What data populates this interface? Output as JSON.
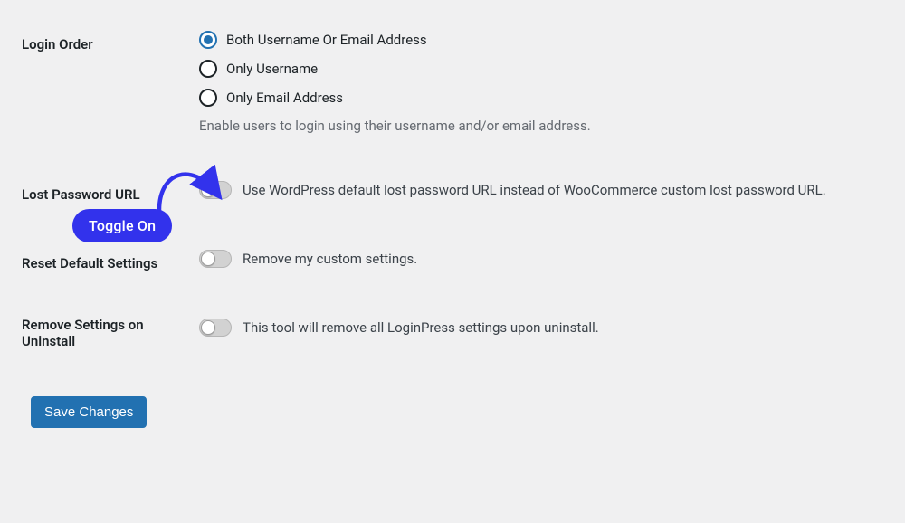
{
  "loginOrder": {
    "label": "Login Order",
    "options": [
      {
        "label": "Both Username Or Email Address",
        "checked": true
      },
      {
        "label": "Only Username",
        "checked": false
      },
      {
        "label": "Only Email Address",
        "checked": false
      }
    ],
    "help": "Enable users to login using their username and/or email address."
  },
  "lostPassword": {
    "label": "Lost Password URL",
    "toggleLabel": "Use WordPress default lost password URL instead of WooCommerce custom lost password URL."
  },
  "resetDefaults": {
    "label": "Reset Default Settings",
    "toggleLabel": "Remove my custom settings."
  },
  "removeOnUninstall": {
    "label": "Remove Settings on Uninstall",
    "toggleLabel": "This tool will remove all LoginPress settings upon uninstall."
  },
  "saveButton": "Save Changes",
  "annotation": {
    "pill": "Toggle On"
  }
}
